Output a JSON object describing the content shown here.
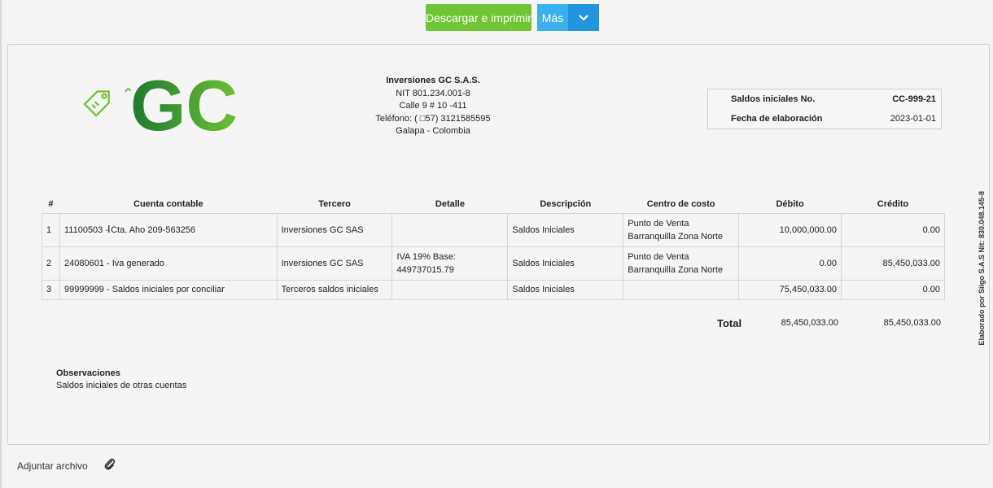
{
  "toolbar": {
    "download_label": "Descargar e imprimir",
    "more_label": "Más",
    "more_caret": "⌄"
  },
  "company": {
    "name": "Inversiones GC S.A.S.",
    "nit": "NIT 801.234.001-8",
    "address": "Calle 9 # 10 -411",
    "phone": "Teléfono: ( □57) 3121585595",
    "location": "Galapa - Colombia"
  },
  "logo": {
    "text": "GC",
    "color_dark": "#1e7a2e",
    "color_light": "#6cc133"
  },
  "meta": {
    "label_number": "Saldos iniciales No.",
    "value_number": "CC-999-21",
    "label_date": "Fecha de elaboración",
    "value_date": "2023-01-01"
  },
  "side_note": "Elaborado por Siigo S.A.S Nit: 830.048.145-8",
  "table": {
    "headers": [
      "#",
      "Cuenta contable",
      "Tercero",
      "Detalle",
      "Descripción",
      "Centro de costo",
      "Débito",
      "Crédito"
    ],
    "rows": [
      {
        "n": "1",
        "cuenta": "11100503 - Cta. Aho 209-563256",
        "tercero": "Inversiones GC SAS",
        "detalle": "",
        "descripcion": "Saldos Iniciales",
        "centro": "Punto de Venta Barranquilla Zona Norte",
        "debito": "10,000,000.00",
        "credito": "0.00"
      },
      {
        "n": "2",
        "cuenta": "24080601 - Iva generado",
        "tercero": "Inversiones GC SAS",
        "detalle": "IVA 19% Base: 449737015.79",
        "descripcion": "Saldos Iniciales",
        "centro": "Punto de Venta Barranquilla Zona Norte",
        "debito": "0.00",
        "credito": "85,450,033.00"
      },
      {
        "n": "3",
        "cuenta": "99999999 - Saldos iniciales por conciliar",
        "tercero": "Terceros saldos iniciales",
        "detalle": "",
        "descripcion": "Saldos Iniciales",
        "centro": "",
        "debito": "75,450,033.00",
        "credito": "0.00"
      }
    ]
  },
  "totals": {
    "label": "Total",
    "debito": "85,450,033.00",
    "credito": "85,450,033.00"
  },
  "observations": {
    "title": "Observaciones",
    "text": "Saldos iniciales de otras cuentas"
  },
  "attach": {
    "label": "Adjuntar archivo"
  }
}
